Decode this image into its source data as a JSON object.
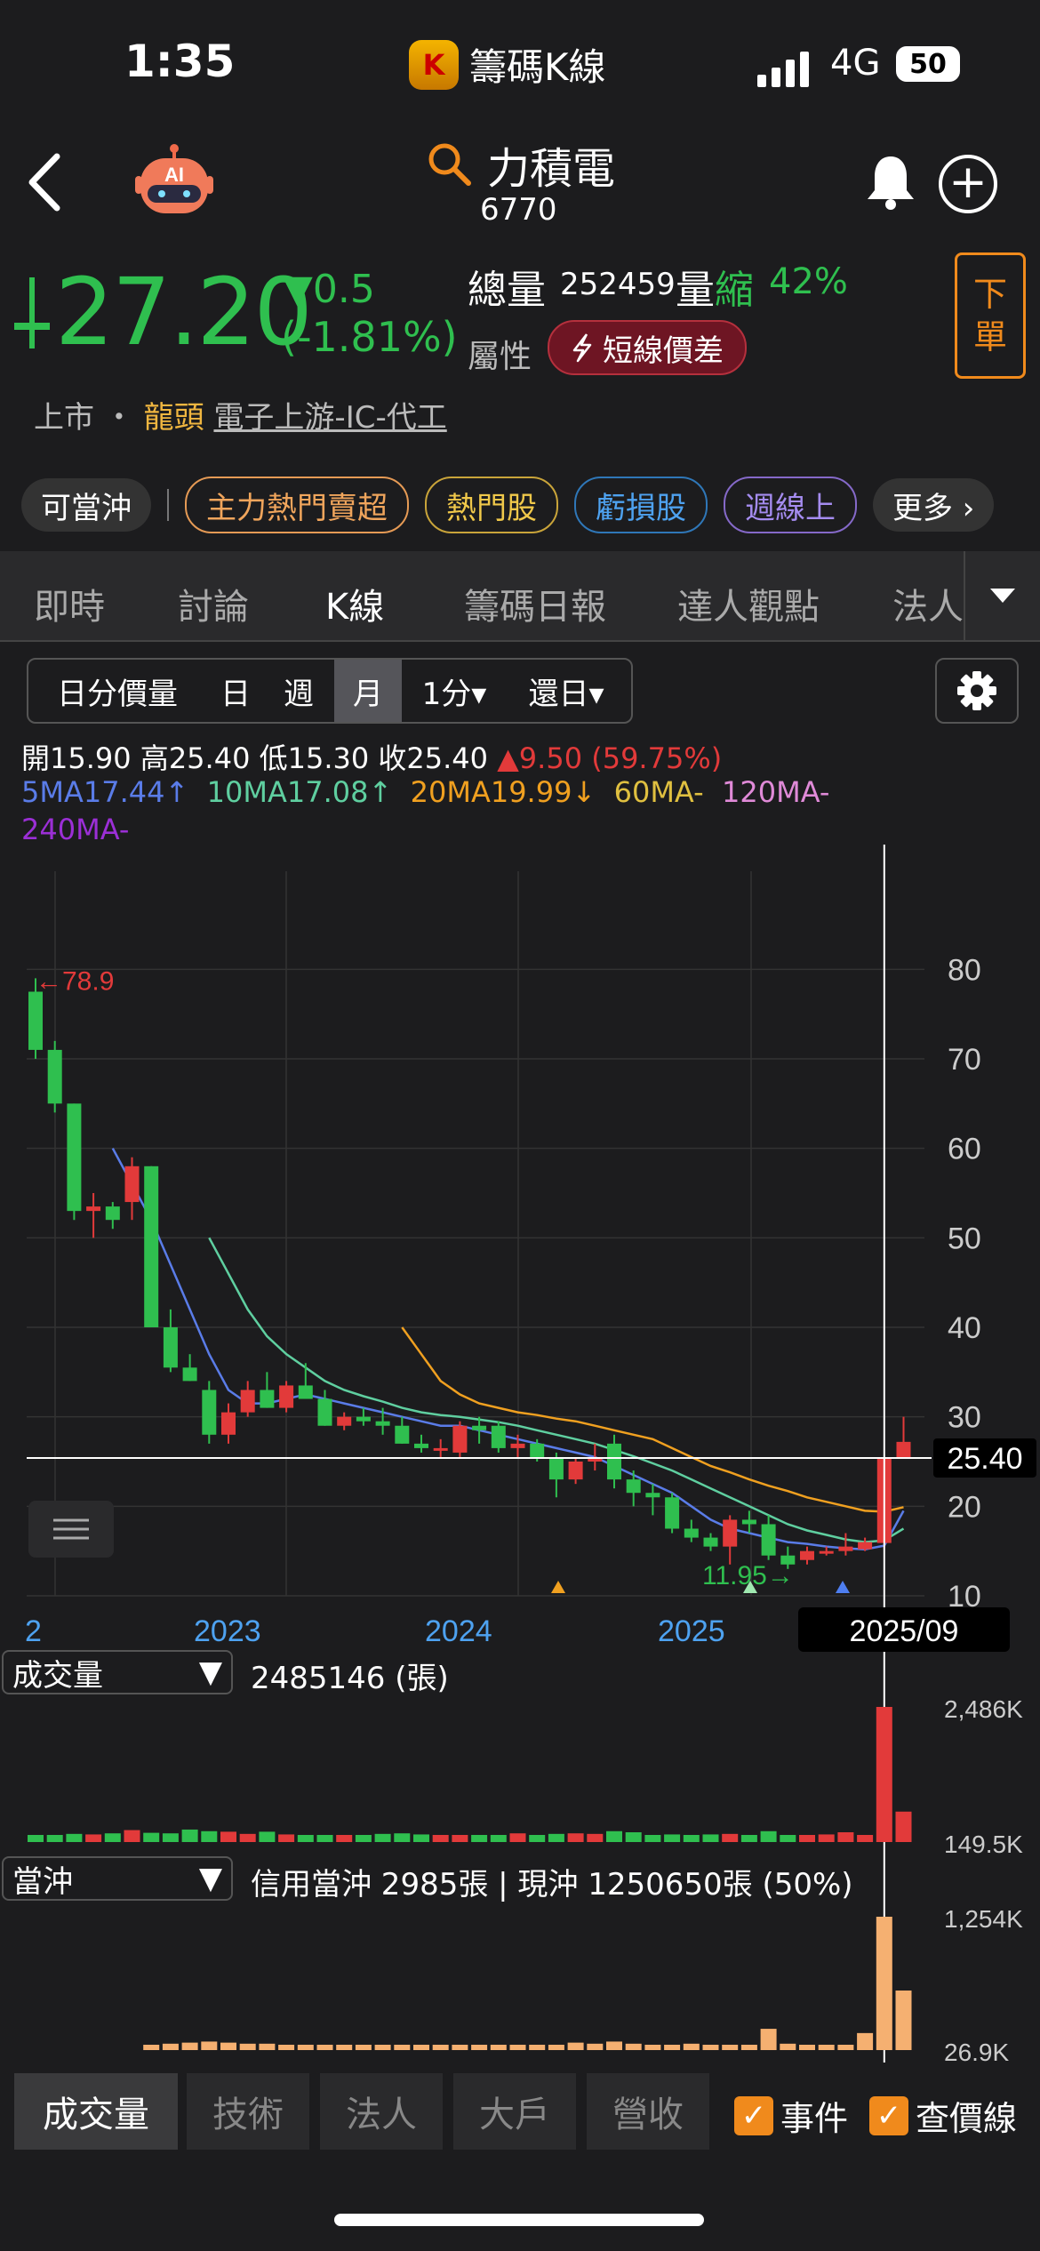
{
  "status": {
    "time": "1:35",
    "app": "籌碼K線",
    "app_icon": "K",
    "network": "4G",
    "battery": "50"
  },
  "header": {
    "title": "力積電",
    "code": "6770",
    "ai_badge": "AI"
  },
  "quote": {
    "price": "27.20",
    "change": "▼0.5",
    "change_pct": "(-1.81%)",
    "volume_label": "總量",
    "volume": "252459",
    "vol_word1": "量",
    "vol_word2": "縮",
    "vol_pct": "42%",
    "attr_label": "屬性",
    "attr_badge": "短線價差",
    "order_button": [
      "下",
      "單"
    ]
  },
  "market": {
    "board": "上市",
    "dot": "・",
    "lead": "龍頭",
    "industry": "電子上游-IC-代工"
  },
  "tags": {
    "first": "可當沖",
    "items": [
      "主力熱門賣超",
      "熱門股",
      "虧損股",
      "週線上",
      "更多 ›"
    ]
  },
  "tabs": [
    "即時",
    "討論",
    "K線",
    "籌碼日報",
    "達人觀點",
    "法人"
  ],
  "periods": {
    "items": [
      "日分價量",
      "日",
      "週",
      "月",
      "1分▾",
      "還日▾"
    ],
    "active": "月"
  },
  "ohlc": {
    "open_label": "開",
    "open": "15.90",
    "high_label": "高",
    "high": "25.40",
    "low_label": "低",
    "low": "15.30",
    "close_label": "收",
    "close": "25.40",
    "chg": "▲9.50 (59.75%)"
  },
  "ma": {
    "ma5": "5MA17.44↑",
    "ma10": "10MA17.08↑",
    "ma20": "20MA19.99↓",
    "ma60": "60MA-",
    "ma120": "120MA-",
    "ma240": "240MA-"
  },
  "colors": {
    "up": "#e23a3a",
    "down": "#2fbf4f",
    "ma5": "#5a7ce8",
    "ma10": "#5fcfa0",
    "ma20": "#f0a020",
    "ma60": "#e0c040",
    "ma120": "#e08ad8",
    "ma240": "#9b2fd6",
    "accent": "#f08a1c"
  },
  "chart_data": [
    {
      "type": "candlestick",
      "title": "",
      "y_ticks": [
        "80",
        "70",
        "60",
        "50",
        "40",
        "30",
        "20",
        "10"
      ],
      "ylim": [
        10,
        85
      ],
      "x_labels": [
        "2",
        "2023",
        "2024",
        "2025"
      ],
      "cursor_price": "25.40",
      "cursor_date": "2025/09",
      "max_label": "←78.9",
      "min_label": "11.95→",
      "candles": [
        {
          "o": 77.5,
          "h": 79,
          "l": 70,
          "c": 71
        },
        {
          "o": 71,
          "h": 72,
          "l": 64,
          "c": 65
        },
        {
          "o": 65,
          "h": 65,
          "l": 52,
          "c": 53
        },
        {
          "o": 53,
          "h": 55,
          "l": 50,
          "c": 53.5
        },
        {
          "o": 53.5,
          "h": 54,
          "l": 51,
          "c": 52
        },
        {
          "o": 54,
          "h": 59,
          "l": 52,
          "c": 58
        },
        {
          "o": 58,
          "h": 58,
          "l": 40,
          "c": 40
        },
        {
          "o": 40,
          "h": 42,
          "l": 35,
          "c": 35.5
        },
        {
          "o": 35.5,
          "h": 37,
          "l": 34,
          "c": 34
        },
        {
          "o": 33,
          "h": 34,
          "l": 27,
          "c": 28
        },
        {
          "o": 28,
          "h": 31.5,
          "l": 27,
          "c": 30.5
        },
        {
          "o": 30.5,
          "h": 34,
          "l": 30,
          "c": 33
        },
        {
          "o": 33,
          "h": 35,
          "l": 31,
          "c": 31
        },
        {
          "o": 31,
          "h": 34,
          "l": 30.5,
          "c": 33.5
        },
        {
          "o": 33.5,
          "h": 36,
          "l": 33,
          "c": 32
        },
        {
          "o": 32,
          "h": 33,
          "l": 29,
          "c": 29
        },
        {
          "o": 29,
          "h": 30.5,
          "l": 28.5,
          "c": 30
        },
        {
          "o": 30,
          "h": 31,
          "l": 29,
          "c": 29.5
        },
        {
          "o": 29.5,
          "h": 31,
          "l": 28,
          "c": 29
        },
        {
          "o": 29,
          "h": 30,
          "l": 27,
          "c": 27
        },
        {
          "o": 27,
          "h": 28,
          "l": 26,
          "c": 26.5
        },
        {
          "o": 26.5,
          "h": 27.5,
          "l": 25.5,
          "c": 26.5
        },
        {
          "o": 26,
          "h": 29.5,
          "l": 25.5,
          "c": 29
        },
        {
          "o": 29,
          "h": 30,
          "l": 27,
          "c": 28.5
        },
        {
          "o": 29,
          "h": 29.5,
          "l": 26,
          "c": 26.5
        },
        {
          "o": 26.5,
          "h": 28,
          "l": 25.5,
          "c": 27
        },
        {
          "o": 27,
          "h": 27.5,
          "l": 25,
          "c": 25.5
        },
        {
          "o": 25.5,
          "h": 26,
          "l": 21,
          "c": 23
        },
        {
          "o": 23,
          "h": 25.5,
          "l": 22.5,
          "c": 25
        },
        {
          "o": 25,
          "h": 27,
          "l": 24,
          "c": 25.5
        },
        {
          "o": 27,
          "h": 28,
          "l": 22,
          "c": 23
        },
        {
          "o": 23,
          "h": 24,
          "l": 20,
          "c": 21.5
        },
        {
          "o": 21.5,
          "h": 22.5,
          "l": 19,
          "c": 21
        },
        {
          "o": 21,
          "h": 21.5,
          "l": 17,
          "c": 17.5
        },
        {
          "o": 17.5,
          "h": 18.5,
          "l": 16,
          "c": 16.5
        },
        {
          "o": 16.5,
          "h": 17,
          "l": 15,
          "c": 15.5
        },
        {
          "o": 15.5,
          "h": 19,
          "l": 13.5,
          "c": 18.5
        },
        {
          "o": 18.5,
          "h": 19.5,
          "l": 17,
          "c": 18
        },
        {
          "o": 18,
          "h": 19,
          "l": 14,
          "c": 14.5
        },
        {
          "o": 14.5,
          "h": 15.5,
          "l": 13,
          "c": 13.5
        },
        {
          "o": 14,
          "h": 15.5,
          "l": 13.5,
          "c": 15
        },
        {
          "o": 15,
          "h": 15.5,
          "l": 14.5,
          "c": 15
        },
        {
          "o": 15,
          "h": 17,
          "l": 14.5,
          "c": 15.5
        },
        {
          "o": 15.2,
          "h": 16.5,
          "l": 15,
          "c": 16
        },
        {
          "o": 15.9,
          "h": 25.4,
          "l": 15.3,
          "c": 25.4
        },
        {
          "o": 25.4,
          "h": 30,
          "l": 25.4,
          "c": 27.2
        }
      ],
      "ma5": [
        null,
        null,
        null,
        null,
        60,
        56,
        52,
        47,
        42,
        37,
        33,
        31.5,
        31.5,
        32,
        32.5,
        32,
        31.5,
        31,
        30.5,
        30,
        29.5,
        29,
        29,
        28.5,
        28,
        27.5,
        27,
        26.5,
        26,
        25.5,
        24.5,
        23.5,
        22.5,
        21.5,
        20,
        18.5,
        17.5,
        17,
        16.5,
        16,
        15.8,
        15.5,
        15.3,
        15.2,
        15.6,
        19.5
      ],
      "ma10": [
        null,
        null,
        null,
        null,
        null,
        null,
        null,
        null,
        null,
        50,
        46,
        42,
        39,
        37,
        35.5,
        34,
        33,
        32.3,
        31.7,
        31,
        30.5,
        30.2,
        30,
        29.7,
        29.4,
        29,
        28.5,
        28,
        27.5,
        27,
        26.3,
        25.6,
        24.8,
        24,
        23,
        22,
        21,
        20,
        19,
        18,
        17.3,
        16.8,
        16.3,
        16,
        16.2,
        17.5
      ],
      "ma20": [
        null,
        null,
        null,
        null,
        null,
        null,
        null,
        null,
        null,
        null,
        null,
        null,
        null,
        null,
        null,
        null,
        null,
        null,
        null,
        40,
        37,
        34,
        32.5,
        31.5,
        31,
        30.5,
        30.2,
        29.8,
        29.5,
        29,
        28.5,
        28,
        27.5,
        26.5,
        25.5,
        24.5,
        23.8,
        23,
        22.3,
        21.7,
        21,
        20.5,
        20,
        19.5,
        19.4,
        19.9
      ]
    },
    {
      "type": "bar",
      "title": "成交量",
      "top_label": "2,486K",
      "bottom_label": "149.5K",
      "values": [
        80,
        120,
        150,
        140,
        160,
        220,
        170,
        160,
        230,
        200,
        190,
        150,
        190,
        140,
        110,
        130,
        90,
        120,
        150,
        160,
        140,
        130,
        90,
        90,
        110,
        160,
        120,
        150,
        160,
        150,
        200,
        180,
        130,
        140,
        120,
        140,
        150,
        120,
        200,
        120,
        110,
        140,
        180,
        100,
        2486,
        560
      ]
    },
    {
      "type": "bar",
      "title": "當沖",
      "top_label": "1,254K",
      "bottom_label": "26.9K",
      "values": [
        null,
        null,
        null,
        null,
        null,
        null,
        40,
        60,
        70,
        80,
        70,
        60,
        60,
        50,
        40,
        40,
        30,
        40,
        30,
        30,
        30,
        40,
        30,
        40,
        50,
        40,
        50,
        40,
        70,
        60,
        80,
        60,
        50,
        50,
        60,
        40,
        40,
        40,
        200,
        60,
        40,
        40,
        40,
        160,
        1254,
        560
      ]
    }
  ],
  "volume_panel": {
    "select": "成交量",
    "info": "2485146 (張)"
  },
  "daytrade_panel": {
    "select": "當沖",
    "info": "信用當沖 2985張 | 現沖 1250650張 (50%)"
  },
  "bottom_tabs": [
    "成交量",
    "技術",
    "法人",
    "大戶",
    "營收"
  ],
  "checks": {
    "event": "事件",
    "price_line": "查價線"
  }
}
